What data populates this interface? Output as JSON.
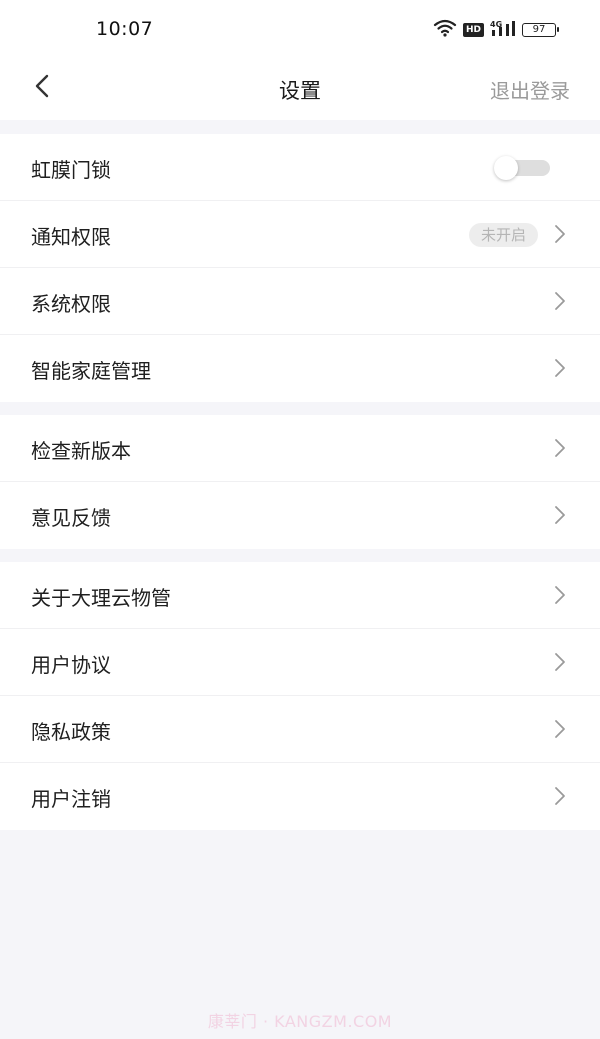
{
  "status_bar": {
    "time": "10:07",
    "hd": "HD",
    "network": "4G",
    "battery": "97"
  },
  "header": {
    "title": "设置",
    "logout_label": "退出登录",
    "back_icon": "chevron-left-icon"
  },
  "groups": [
    {
      "items": [
        {
          "label": "虹膜门锁",
          "control": "toggle",
          "toggle_on": false
        },
        {
          "label": "通知权限",
          "control": "chevron",
          "status": "未开启"
        },
        {
          "label": "系统权限",
          "control": "chevron"
        },
        {
          "label": "智能家庭管理",
          "control": "chevron"
        }
      ]
    },
    {
      "items": [
        {
          "label": "检查新版本",
          "control": "chevron"
        },
        {
          "label": "意见反馈",
          "control": "chevron"
        }
      ]
    },
    {
      "items": [
        {
          "label": "关于大理云物管",
          "control": "chevron"
        },
        {
          "label": "用户协议",
          "control": "chevron"
        },
        {
          "label": "隐私政策",
          "control": "chevron"
        },
        {
          "label": "用户注销",
          "control": "chevron"
        }
      ]
    }
  ],
  "watermark": "康莘门 · KANGZM.COM",
  "colors": {
    "background": "#f5f5f9",
    "surface": "#ffffff",
    "muted_text": "#9a9a9a",
    "chevron": "#9a9a9a"
  }
}
